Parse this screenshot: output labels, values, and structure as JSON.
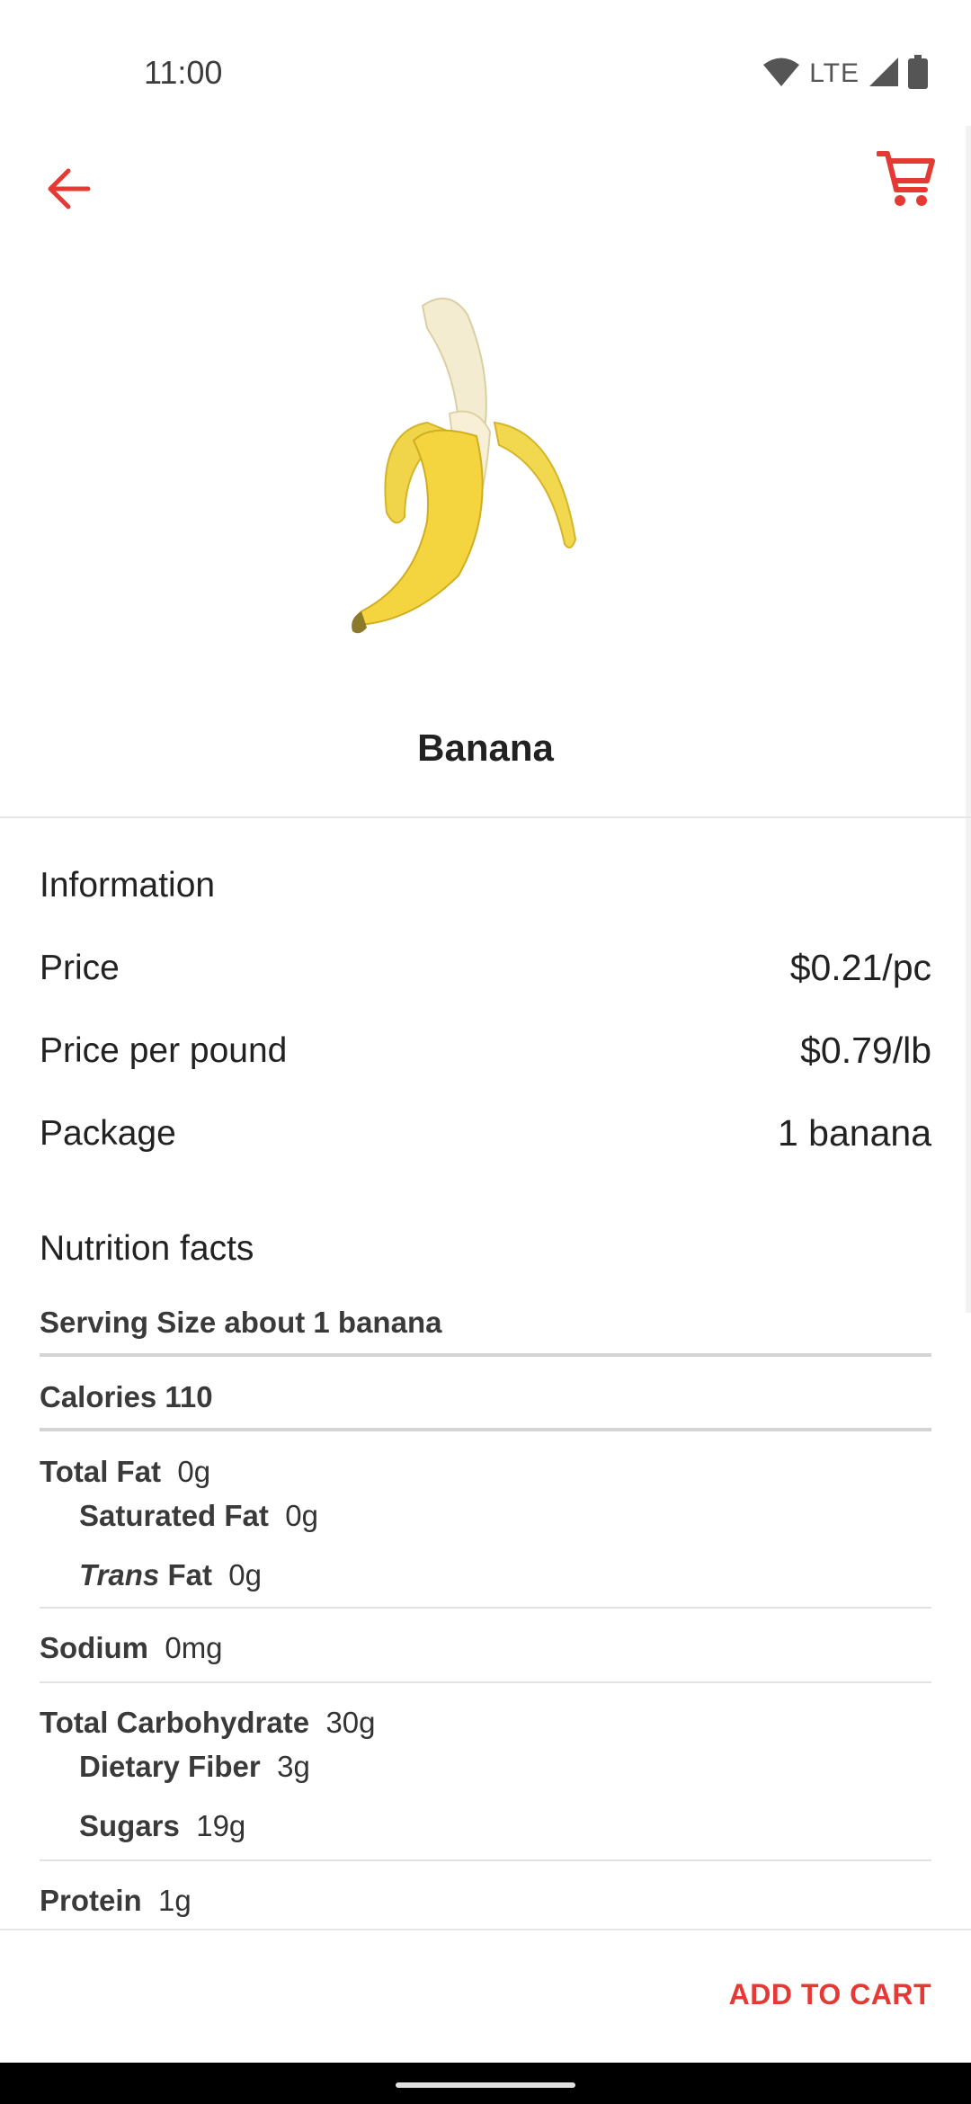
{
  "status_bar": {
    "time": "11:00",
    "network": "LTE",
    "icons": [
      "wifi-icon",
      "signal-icon",
      "battery-icon"
    ]
  },
  "toolbar": {
    "back_icon": "arrow-back-icon",
    "cart_icon": "shopping-cart-icon",
    "accent_color": "#e53935"
  },
  "product": {
    "name": "Banana",
    "image": "banana-image"
  },
  "information": {
    "heading": "Information",
    "rows": [
      {
        "label": "Price",
        "value": "$0.21/pc"
      },
      {
        "label": "Price per pound",
        "value": "$0.79/lb"
      },
      {
        "label": "Package",
        "value": "1 banana"
      }
    ]
  },
  "nutrition": {
    "heading": "Nutrition facts",
    "serving": "Serving Size about 1 banana",
    "calories": "Calories 110",
    "total_fat": {
      "label": "Total Fat",
      "value": "0g"
    },
    "saturated_fat": {
      "label": "Saturated Fat",
      "value": "0g"
    },
    "trans_fat": {
      "label_italic": "Trans",
      "label": "Fat",
      "value": "0g"
    },
    "sodium": {
      "label": "Sodium",
      "value": "0mg"
    },
    "total_carb": {
      "label": "Total Carbohydrate",
      "value": "30g"
    },
    "dietary_fiber": {
      "label": "Dietary Fiber",
      "value": "3g"
    },
    "sugars": {
      "label": "Sugars",
      "value": "19g"
    },
    "protein": {
      "label": "Protein",
      "value": "1g"
    }
  },
  "actions": {
    "add_to_cart": "ADD TO CART"
  }
}
